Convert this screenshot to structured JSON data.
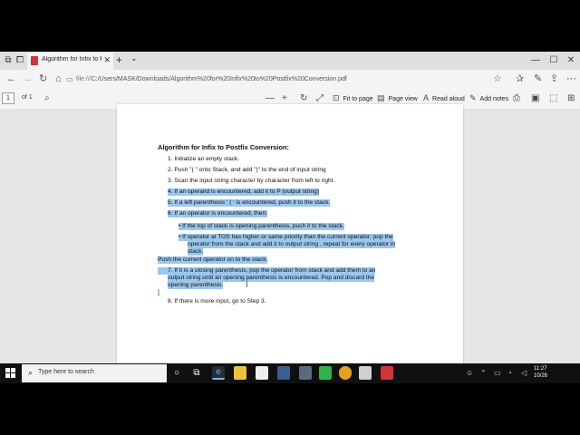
{
  "browser": {
    "tab_title": "Algorithm for Infix to Po",
    "tab_close": "✕",
    "new_tab": "+",
    "tab_menu": "⌄",
    "url_scheme": "file:///",
    "url_path": "C:/Users/MASK/Downloads/Algorithm%20for%20Infix%20to%20Postfix%20Conversion.pdf"
  },
  "pdf_toolbar": {
    "page_current": "1",
    "page_of": "of 1",
    "fit_to_page": "Fit to page",
    "page_view": "Page view",
    "read_aloud": "Read aloud",
    "add_notes": "Add notes"
  },
  "document": {
    "title": "Algorithm for Infix to Postfix Conversion:",
    "step1": "1. Initialize an empty stack.",
    "step2": "2. Push \"( \" onto Stack, and add \")\" to the end of input string",
    "step3": "3. Scan the input string character by character from left to right.",
    "step4": "4. If an operand is encountered, add it to P (output string)",
    "step5": "5. If a left parenthesis ‘ ( ‘ is encountered, push it to the stack.",
    "step6": "6. If an operator is encountered, then:",
    "bullet1": "• If the top of stack is opening parenthesis, push it to the stack.",
    "bullet2_l1": "• If operator at TOS has higher or same priority than the current operator; pop  the",
    "bullet2_l2": "operator from the stack and add it to output string , repeat for every  operator in",
    "bullet2_l3": "stack.",
    "push_line": "Push the current operator on to the stack.",
    "step7_l1": "7. If it is a closing parenthesis, pop the operator from stack and add them to an",
    "step7_l2": "output  string until an opening parenthesis is encountered. Pop and discard the",
    "step7_l3": "opening  parenthesis.",
    "step8": "8. If there is more input, go to Step 3."
  },
  "taskbar": {
    "search_placeholder": "Type here to search",
    "time": "11:27",
    "date": "10/26"
  },
  "colors": {
    "highlight": "#9bc7ee",
    "taskbar": "#101010",
    "pdf_icon": "#d13438"
  }
}
